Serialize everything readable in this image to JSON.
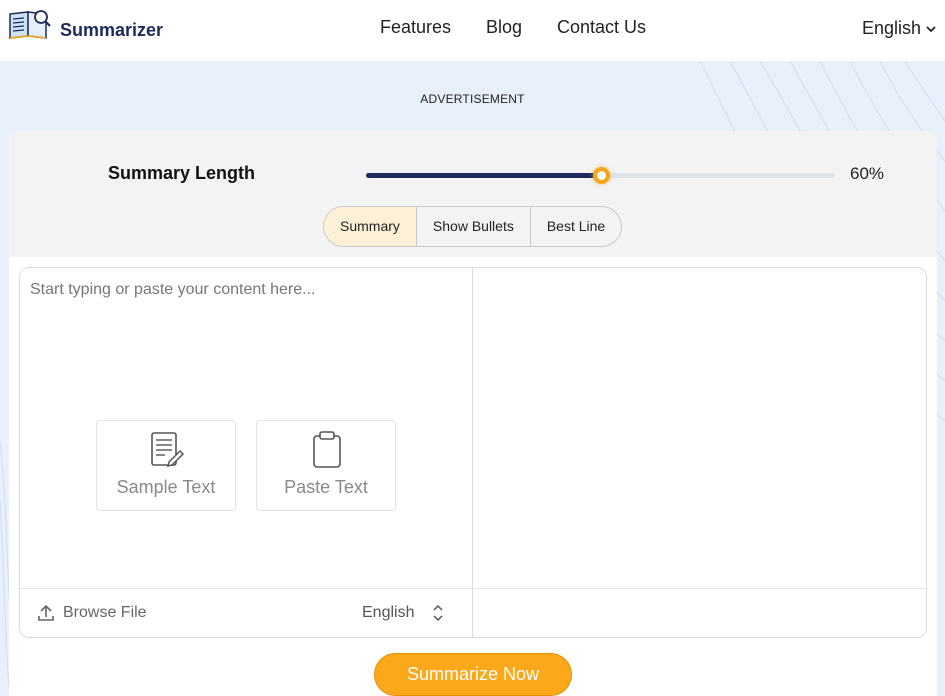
{
  "header": {
    "brand": "Summarizer",
    "nav": [
      {
        "label": "Features"
      },
      {
        "label": "Blog"
      },
      {
        "label": "Contact Us"
      }
    ],
    "language": "English"
  },
  "ad_label": "ADVERTISEMENT",
  "controls": {
    "summary_length_label": "Summary Length",
    "summary_length_value": "60%",
    "summary_length_fraction": 0.5,
    "modes": [
      {
        "label": "Summary",
        "active": true
      },
      {
        "label": "Show Bullets",
        "active": false
      },
      {
        "label": "Best Line",
        "active": false
      }
    ]
  },
  "editor": {
    "placeholder": "Start typing or paste your content here...",
    "sample_text_label": "Sample Text",
    "paste_text_label": "Paste Text",
    "browse_file_label": "Browse File",
    "file_language": "English"
  },
  "summarize_button": "Summarize Now",
  "colors": {
    "brand": "#1f2a5c",
    "accent": "#fba91b",
    "active_mode": "#fdf0d6"
  }
}
